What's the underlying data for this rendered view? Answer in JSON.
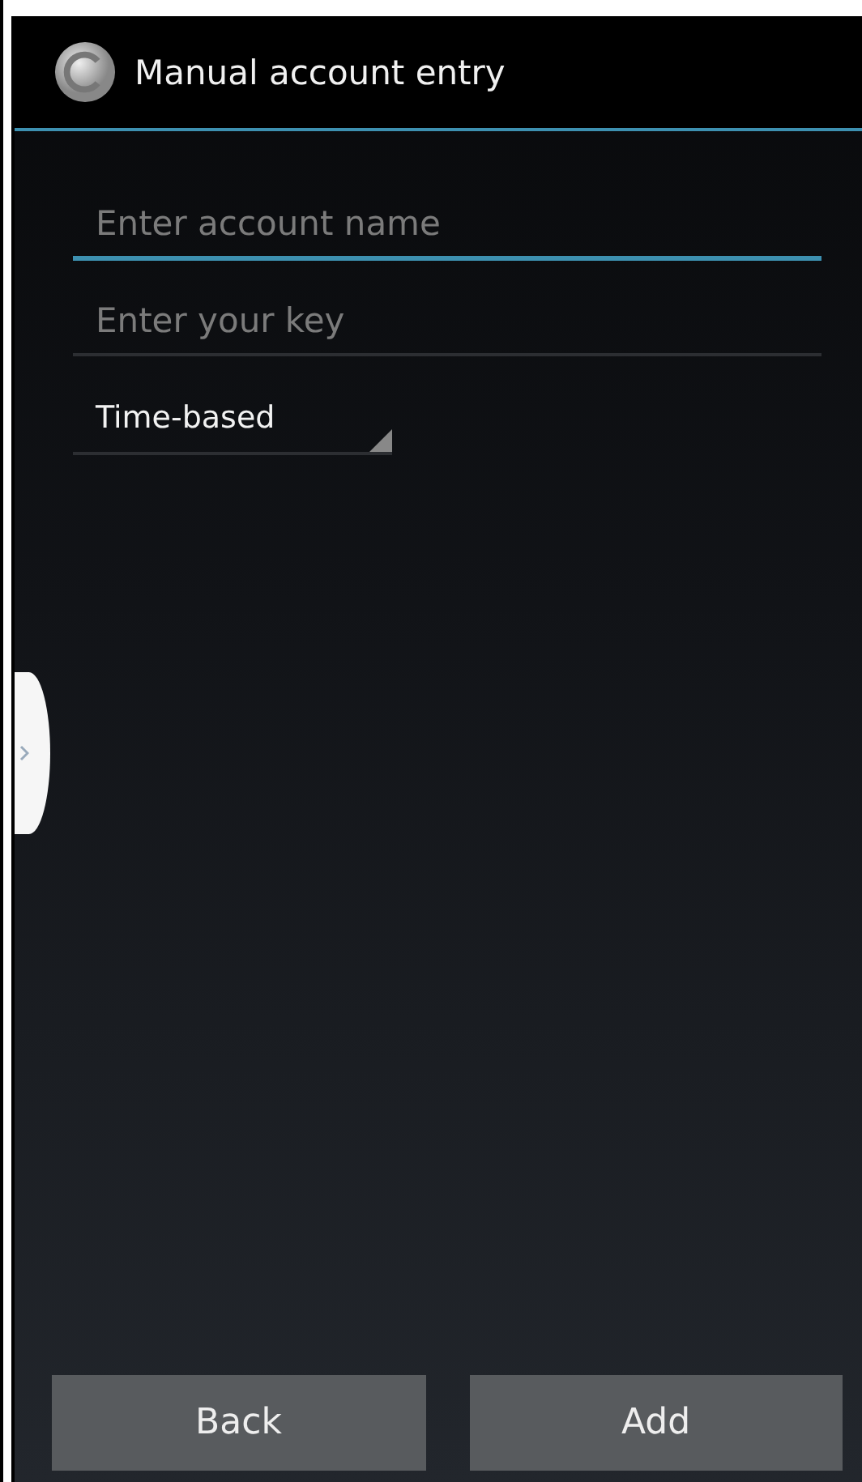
{
  "window": {
    "title": "Manual account entry"
  },
  "fields": [
    {
      "placeholder": "Enter account name",
      "focused": true
    },
    {
      "placeholder": "Enter your key",
      "focused": false
    }
  ],
  "spinner": {
    "value": "Time-based"
  },
  "buttons": [
    "Back",
    "Add"
  ]
}
